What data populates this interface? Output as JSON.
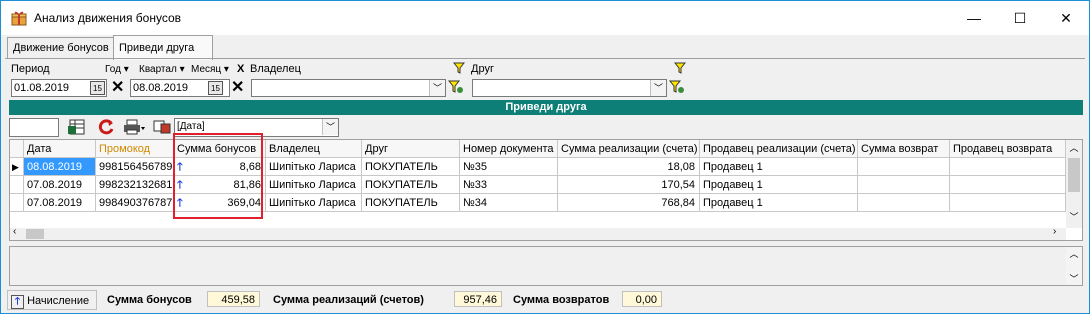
{
  "window": {
    "title": "Анализ движения бонусов",
    "minimize": "—",
    "maximize": "☐",
    "close": "✕"
  },
  "tabs": [
    {
      "label": "Движение бонусов"
    },
    {
      "label": "Приведи друга"
    }
  ],
  "filters": {
    "period_label": "Период",
    "year_label": "Год ▾",
    "quarter_label": "Квартал ▾",
    "month_label": "Месяц ▾",
    "clear_label": "X",
    "owner_label": "Владелец",
    "friend_label": "Друг",
    "date_from": "01.08.2019",
    "date_to": "08.08.2019",
    "owner_value": "",
    "friend_value": ""
  },
  "section_title": "Приведи друга",
  "toolbar": {
    "search_value": "",
    "group_select": "[Дата]"
  },
  "grid": {
    "columns": [
      "Дата",
      "Промокод",
      "Сумма бонусов",
      "Владелец",
      "Друг",
      "Номер документа",
      "Сумма реализации (счета)",
      "Продавец реализации (счета)",
      "Сумма возврат",
      "Продавец возврата"
    ],
    "rows": [
      {
        "date": "08.08.2019",
        "promo": "998156456789",
        "bonus": "8,68",
        "owner": "Шипітько Лариса",
        "friend": "ПОКУПАТЕЛЬ",
        "doc": "№35",
        "sale_sum": "18,08",
        "seller": "Продавец 1",
        "return_sum": "",
        "return_seller": ""
      },
      {
        "date": "07.08.2019",
        "promo": "998232132681",
        "bonus": "81,86",
        "owner": "Шипітько Лариса",
        "friend": "ПОКУПАТЕЛЬ",
        "doc": "№33",
        "sale_sum": "170,54",
        "seller": "Продавец 1",
        "return_sum": "",
        "return_seller": ""
      },
      {
        "date": "07.08.2019",
        "promo": "998490376787",
        "bonus": "369,04",
        "owner": "Шипітько Лариса",
        "friend": "ПОКУПАТЕЛЬ",
        "doc": "№34",
        "sale_sum": "768,84",
        "seller": "Продавец 1",
        "return_sum": "",
        "return_seller": ""
      }
    ]
  },
  "status": {
    "legend_label": "Начисление",
    "bonus_label": "Сумма бонусов",
    "bonus_value": "459,58",
    "sales_label": "Сумма реализаций (счетов)",
    "sales_value": "957,46",
    "returns_label": "Сумма возвратов",
    "returns_value": "0,00"
  },
  "colors": {
    "accent": "#0d7f76",
    "highlight": "#e0202a",
    "selected": "#3399ff",
    "promo_header": "#d08a00",
    "arrow": "#1e3fd8"
  }
}
